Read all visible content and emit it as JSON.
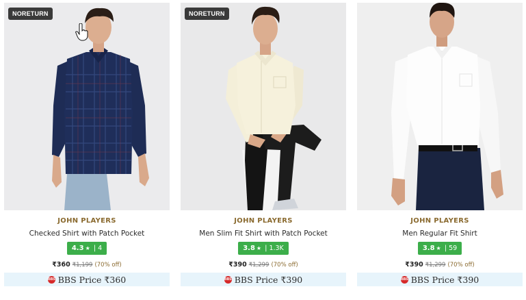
{
  "colors": {
    "badge_bg": "#3a3a3a",
    "brand_text": "#8a6a2f",
    "rating_bg": "#3cae4a",
    "bbs_bg": "#e7f4fb",
    "bbs_icon": "#d62a2a"
  },
  "products": [
    {
      "badge": "NORETURN",
      "brand": "JOHN PLAYERS",
      "name": "Checked Shirt with Patch Pocket",
      "rating": "4.3",
      "rating_count": "4",
      "price": "₹360",
      "mrp": "₹1,199",
      "discount": "(70% off)",
      "bbs_icon_text": "BBS",
      "bbs_label": "BBS Price ₹360",
      "shirt_color": "navy-check"
    },
    {
      "badge": "NORETURN",
      "brand": "JOHN PLAYERS",
      "name": "Men Slim Fit Shirt with Patch Pocket",
      "rating": "3.8",
      "rating_count": "1.3K",
      "price": "₹390",
      "mrp": "₹1,299",
      "discount": "(70% off)",
      "bbs_icon_text": "BBS",
      "bbs_label": "BBS Price ₹390",
      "shirt_color": "cream"
    },
    {
      "badge": "",
      "brand": "JOHN PLAYERS",
      "name": "Men Regular Fit Shirt",
      "rating": "3.8",
      "rating_count": "59",
      "price": "₹390",
      "mrp": "₹1,299",
      "discount": "(70% off)",
      "bbs_icon_text": "BBS",
      "bbs_label": "BBS Price ₹390",
      "shirt_color": "white"
    }
  ],
  "rating_star": "★",
  "rating_sep": "|"
}
